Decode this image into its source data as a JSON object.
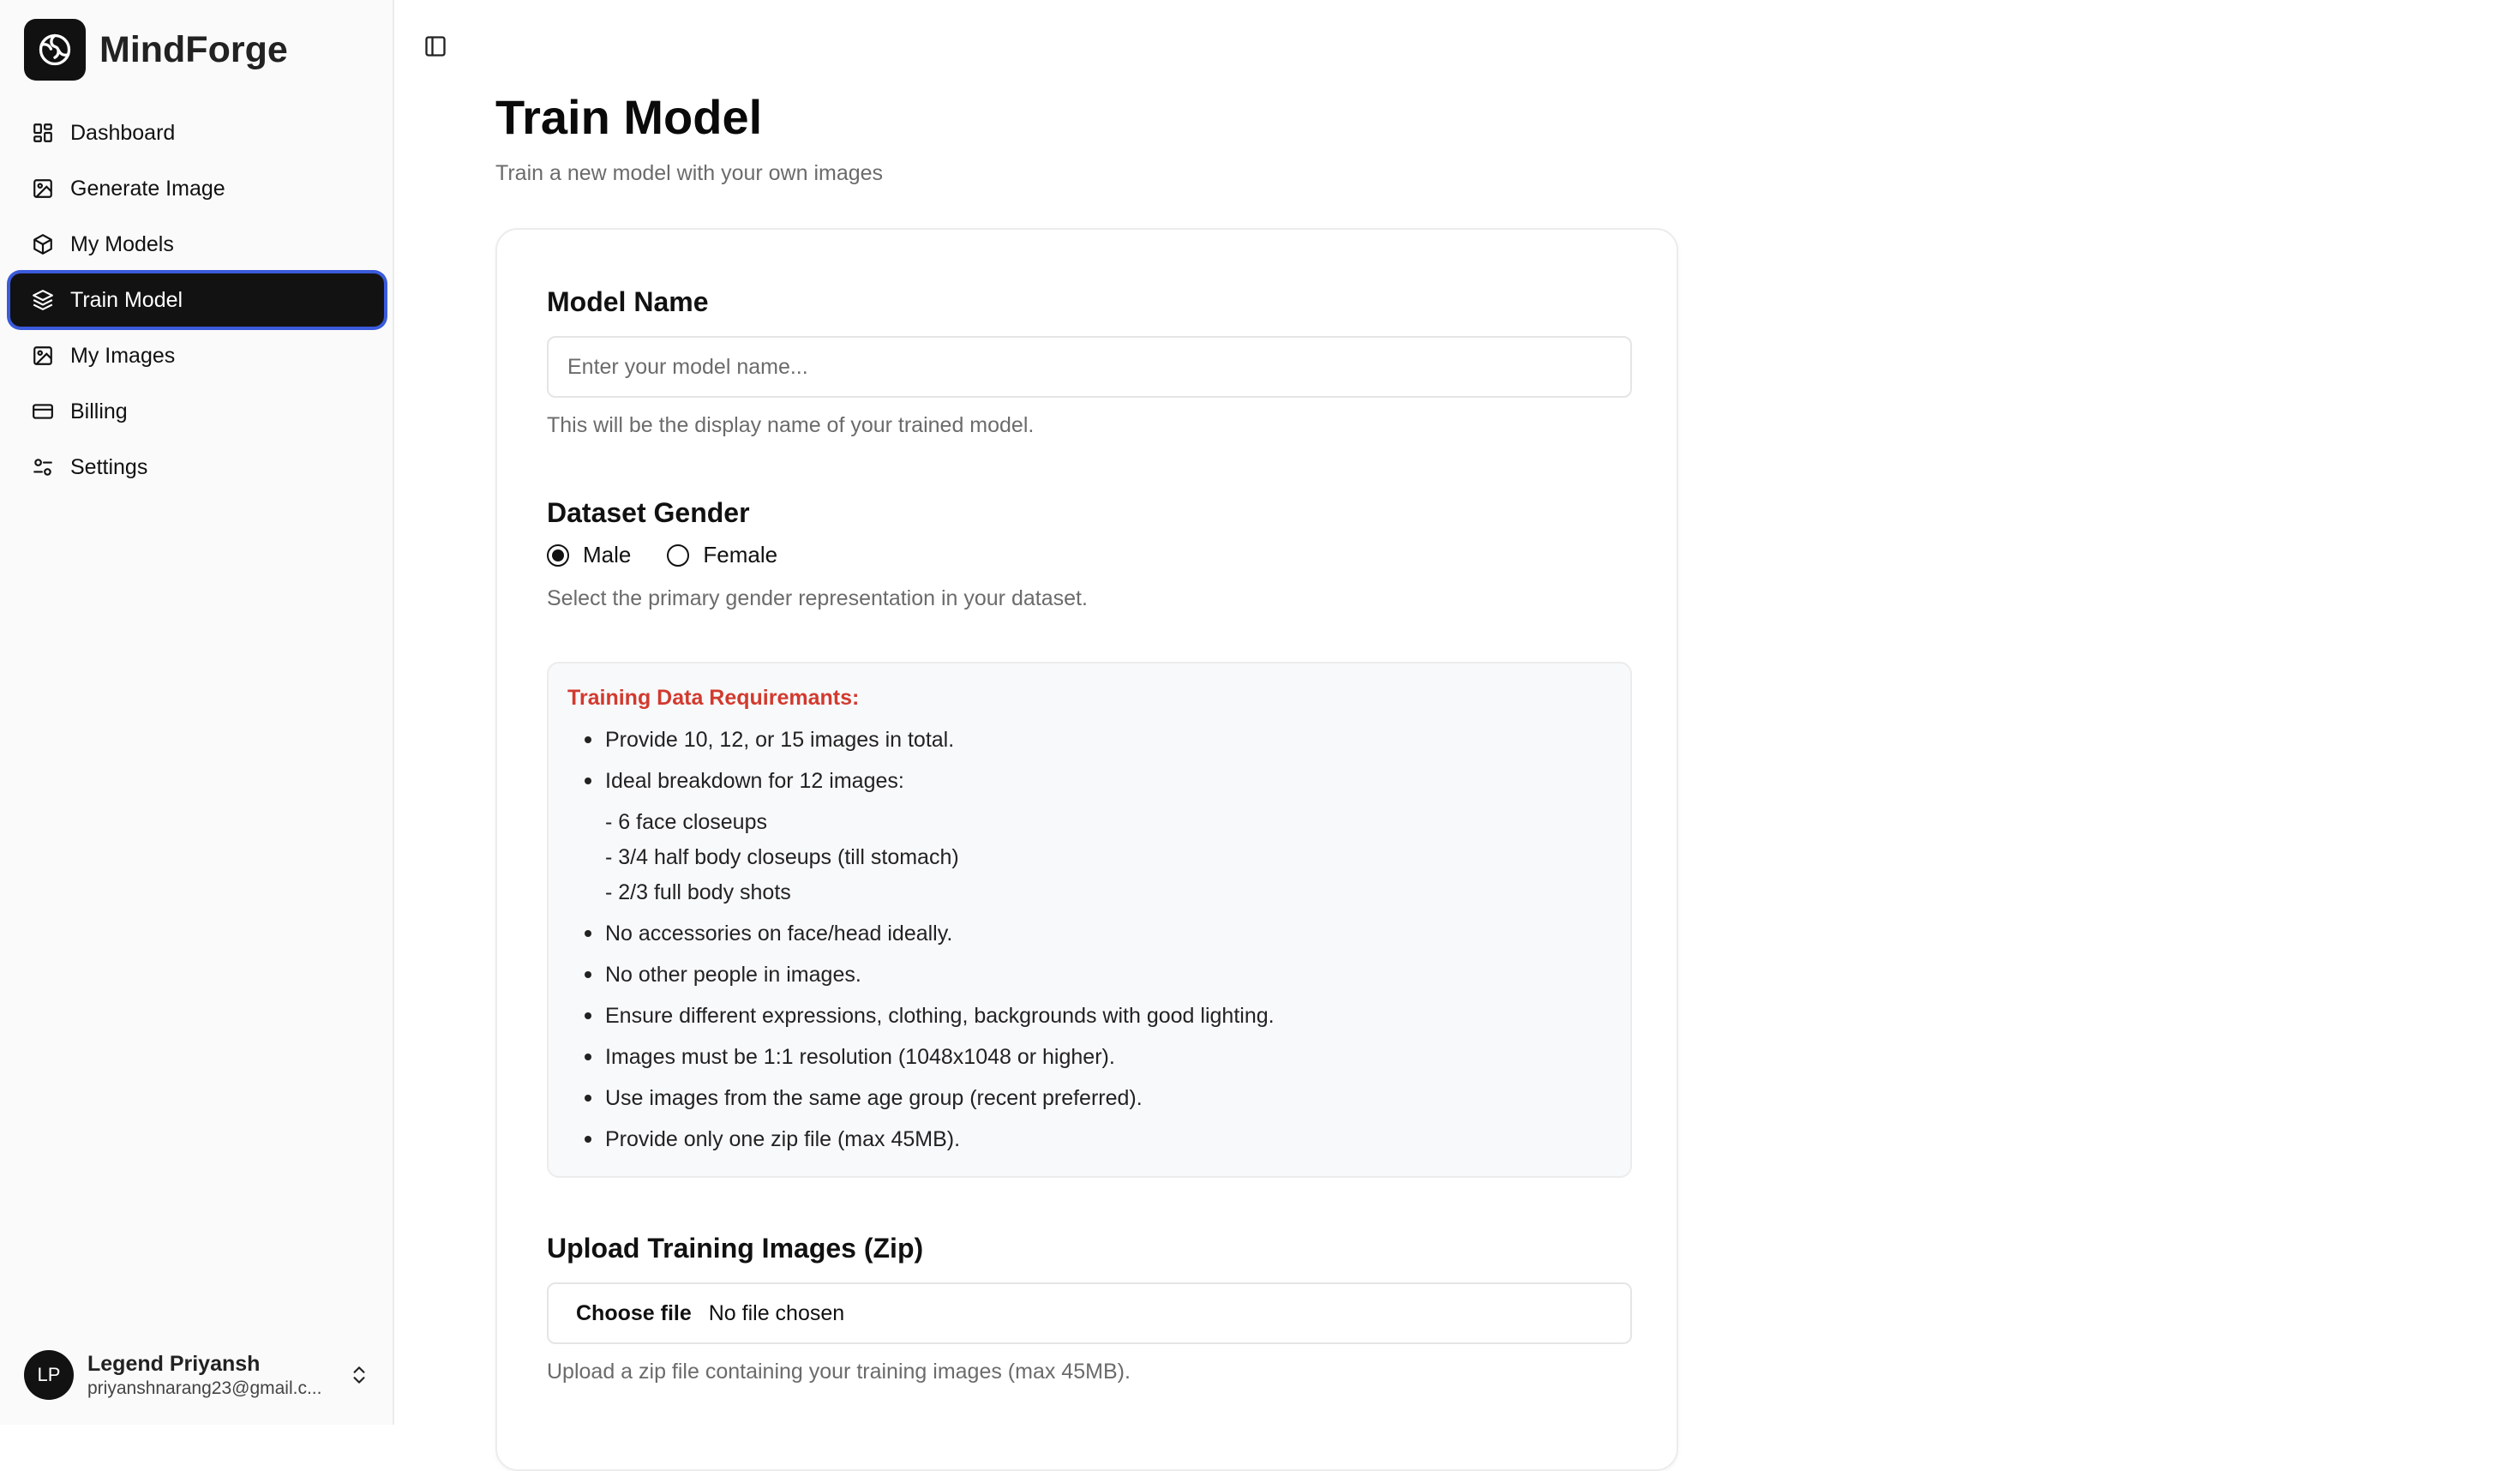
{
  "brand": {
    "name": "MindForge"
  },
  "sidebar": {
    "items": [
      {
        "label": "Dashboard",
        "icon": "dashboard-icon",
        "active": false
      },
      {
        "label": "Generate Image",
        "icon": "image-icon",
        "active": false
      },
      {
        "label": "My Models",
        "icon": "box-icon",
        "active": false
      },
      {
        "label": "Train Model",
        "icon": "layers-icon",
        "active": true
      },
      {
        "label": "My Images",
        "icon": "image-icon",
        "active": false
      },
      {
        "label": "Billing",
        "icon": "credit-card-icon",
        "active": false
      },
      {
        "label": "Settings",
        "icon": "settings-sliders-icon",
        "active": false
      }
    ]
  },
  "user": {
    "initials": "LP",
    "name": "Legend Priyansh",
    "email": "priyanshnarang23@gmail.c..."
  },
  "page": {
    "title": "Train Model",
    "subtitle": "Train a new model with your own images"
  },
  "form": {
    "model_name": {
      "label": "Model Name",
      "placeholder": "Enter your model name...",
      "value": "",
      "hint": "This will be the display name of your trained model."
    },
    "gender": {
      "label": "Dataset Gender",
      "options": [
        {
          "label": "Male",
          "selected": true
        },
        {
          "label": "Female",
          "selected": false
        }
      ],
      "hint": "Select the primary gender representation in your dataset."
    },
    "requirements": {
      "title": "Training Data Requiremants:",
      "items": [
        "Provide 10, 12, or 15 images in total.",
        "Ideal breakdown for 12 images:",
        "No accessories on face/head ideally.",
        "No other people in images.",
        "Ensure different expressions, clothing, backgrounds with good lighting.",
        "Images must be 1:1 resolution (1048x1048 or higher).",
        "Use images from the same age group (recent preferred).",
        "Provide only one zip file (max 45MB)."
      ],
      "breakdown": [
        "- 6 face closeups",
        "- 3/4 half body closeups (till stomach)",
        "- 2/3 full body shots"
      ]
    },
    "upload": {
      "label": "Upload Training Images (Zip)",
      "button": "Choose file",
      "status": "No file chosen",
      "hint": "Upload a zip file containing your training images (max 45MB)."
    }
  },
  "colors": {
    "accent_dark": "#121212",
    "active_ring": "#3b5bdb",
    "requirements_title": "#d23a2e"
  }
}
